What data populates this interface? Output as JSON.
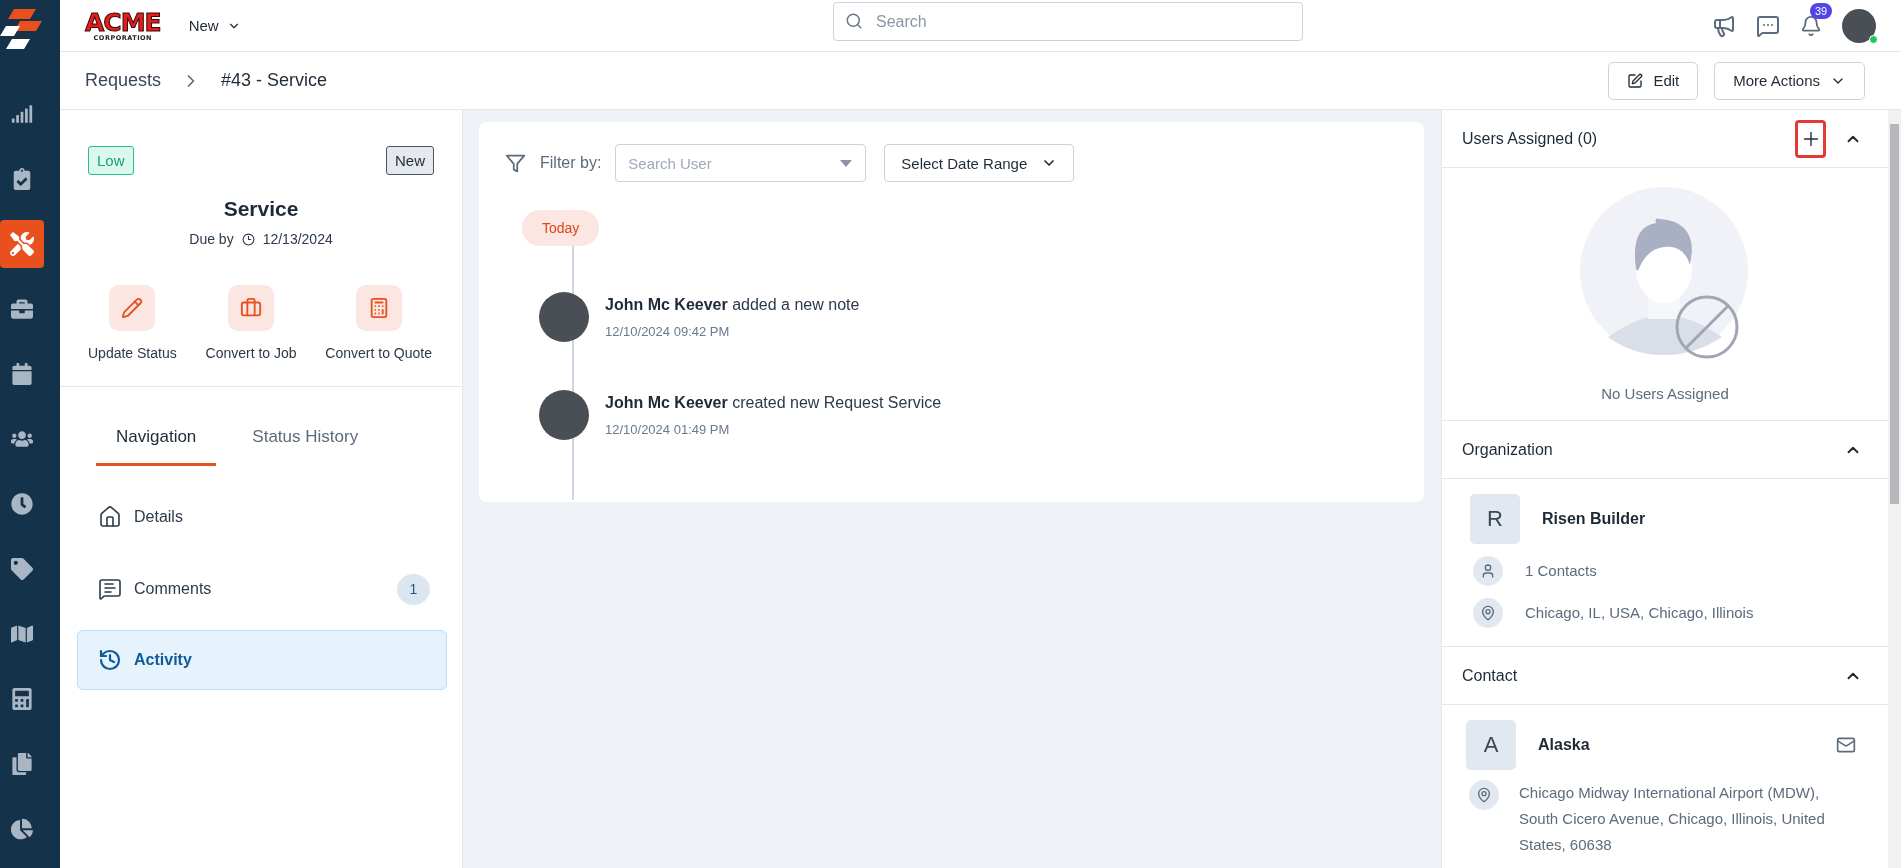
{
  "sidebar": {
    "items": [
      {
        "kind": "chart",
        "selected": false
      },
      {
        "kind": "clipboard",
        "selected": false
      },
      {
        "kind": "tools",
        "selected": true
      },
      {
        "kind": "briefcase",
        "selected": false
      },
      {
        "kind": "calendar",
        "selected": false
      },
      {
        "kind": "users",
        "selected": false
      },
      {
        "kind": "clock",
        "selected": false
      },
      {
        "kind": "tag",
        "selected": false
      },
      {
        "kind": "map",
        "selected": false
      },
      {
        "kind": "calculator",
        "selected": false
      },
      {
        "kind": "files",
        "selected": false
      },
      {
        "kind": "pie",
        "selected": false
      }
    ]
  },
  "header": {
    "logo": {
      "name": "ACME",
      "subtitle": "CORPORATION"
    },
    "new_menu": "New",
    "search": {
      "placeholder": "Search"
    },
    "notifications": "39",
    "user": {
      "online": true
    }
  },
  "breadcrumb": {
    "items": [
      "Requests",
      "#43 - Service"
    ],
    "buttons": [
      {
        "kind": "edit",
        "label": "Edit"
      },
      {
        "kind": "menu",
        "label": "More Actions"
      }
    ]
  },
  "request": {
    "priority": "Low",
    "status": "New",
    "title": "Service",
    "due_label": "Due by",
    "due_date": "12/13/2024",
    "actions": [
      {
        "kind": "pencil",
        "label": "Update Status"
      },
      {
        "kind": "briefcase",
        "label": "Convert to Job"
      },
      {
        "kind": "calculator",
        "label": "Convert to Quote"
      }
    ]
  },
  "tabs": [
    {
      "label": "Navigation",
      "selected": true
    },
    {
      "label": "Status History",
      "selected": false
    }
  ],
  "nav_items": [
    {
      "kind": "home",
      "label": "Details",
      "selected": false
    },
    {
      "kind": "comments",
      "label": "Comments",
      "count": "1",
      "selected": false
    },
    {
      "kind": "history",
      "label": "Activity",
      "selected": true
    }
  ],
  "activity": {
    "filter_label": "Filter by:",
    "user_select": {
      "placeholder": "Search User"
    },
    "date_range": "Select Date Range",
    "day": "Today",
    "entries": [
      {
        "text": "**John Mc Keever** added a new note",
        "time": "12/10/2024 09:42 PM"
      },
      {
        "text": "**John Mc Keever** created new Request Service",
        "time": "12/10/2024 01:49 PM"
      }
    ]
  },
  "users_assigned": {
    "title": "Users Assigned (0)",
    "expanded": true,
    "empty_text": "No Users Assigned"
  },
  "organization": {
    "title": "Organization",
    "expanded": true,
    "initial": "R",
    "name": "Risen Builder",
    "contacts": "1 Contacts",
    "location": "Chicago, IL, USA, Chicago, Illinois"
  },
  "contact": {
    "title": "Contact",
    "expanded": true,
    "initial": "A",
    "name": "Alaska",
    "address": "Chicago Midway International Airport (MDW), South Cicero Avenue, Chicago, Illinois, United States, 60638"
  }
}
